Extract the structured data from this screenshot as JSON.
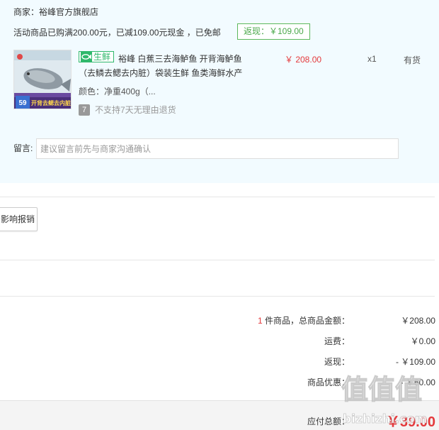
{
  "store": {
    "merchant": "商家：裕峰官方旗舰店",
    "promo_text": "活动商品已购满200.00元，已减109.00元现金 ，已免邮",
    "cashback_badge": "返现：￥109.00"
  },
  "item": {
    "tag": "生鲜",
    "title": "裕峰 白蕉三去海鲈鱼 开背海鲈鱼（去鳞去鳃去内脏）袋装生鲜 鱼类海鲜水产",
    "price": "￥ 208.00",
    "qty": "x1",
    "stock": "有货",
    "spec": "颜色：净重400g（...",
    "no_return_icon": "7",
    "no_return": "不支持7天无理由退货",
    "thumb_badge_price": "59",
    "thumb_badge_text": "开背去鳃去内脏"
  },
  "message": {
    "label": "留言:",
    "placeholder": "建议留言前先与商家沟通确认"
  },
  "invoice": {
    "button_label": "影响报销"
  },
  "summary": {
    "count": "1",
    "count_label": " 件商品，总商品金额：",
    "total": "￥208.00",
    "shipping_label": "运费：",
    "shipping": "￥0.00",
    "cashback_label": "返现：",
    "cashback": "- ￥109.00",
    "discount_label": "商品优惠：",
    "discount": "- ￥60.00",
    "payable_label": "应付总额：",
    "payable": "￥39.00"
  },
  "watermark": {
    "glyphs": "值值值",
    "url": "bizhizhi.com"
  },
  "colors": {
    "accent_red": "#e4393c",
    "cashback_green": "#4aa84a",
    "fresh_green": "#2fb86b",
    "store_bg": "#f2fbff"
  },
  "icons": {
    "fresh_tag": "fish-icon",
    "no_return": "seven-day-icon"
  }
}
